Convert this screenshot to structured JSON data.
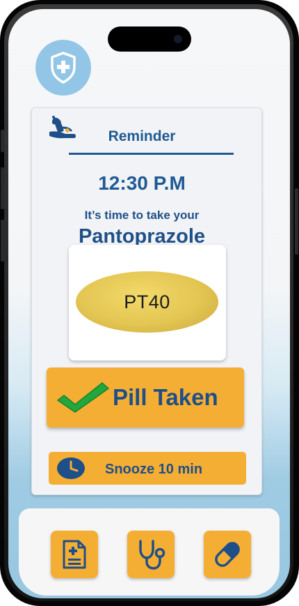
{
  "app": {
    "logo_icon": "shield-plus-icon",
    "accent_color": "#1f5a94",
    "button_color": "#f5ae34"
  },
  "reminder": {
    "title": "Reminder",
    "time": "12:30 P.M",
    "message": "It’s time to  take your",
    "medication": "Pantoprazole",
    "pill_imprint": "PT40",
    "bell_icon": "bell-icon"
  },
  "actions": {
    "taken_label": "Pill Taken",
    "taken_icon": "checkmark-icon",
    "snooze_label": "Snooze 10 min",
    "snooze_icon": "clock-icon"
  },
  "nav": {
    "items": [
      {
        "icon": "medical-document-icon"
      },
      {
        "icon": "stethoscope-icon"
      },
      {
        "icon": "capsule-icon"
      }
    ]
  }
}
